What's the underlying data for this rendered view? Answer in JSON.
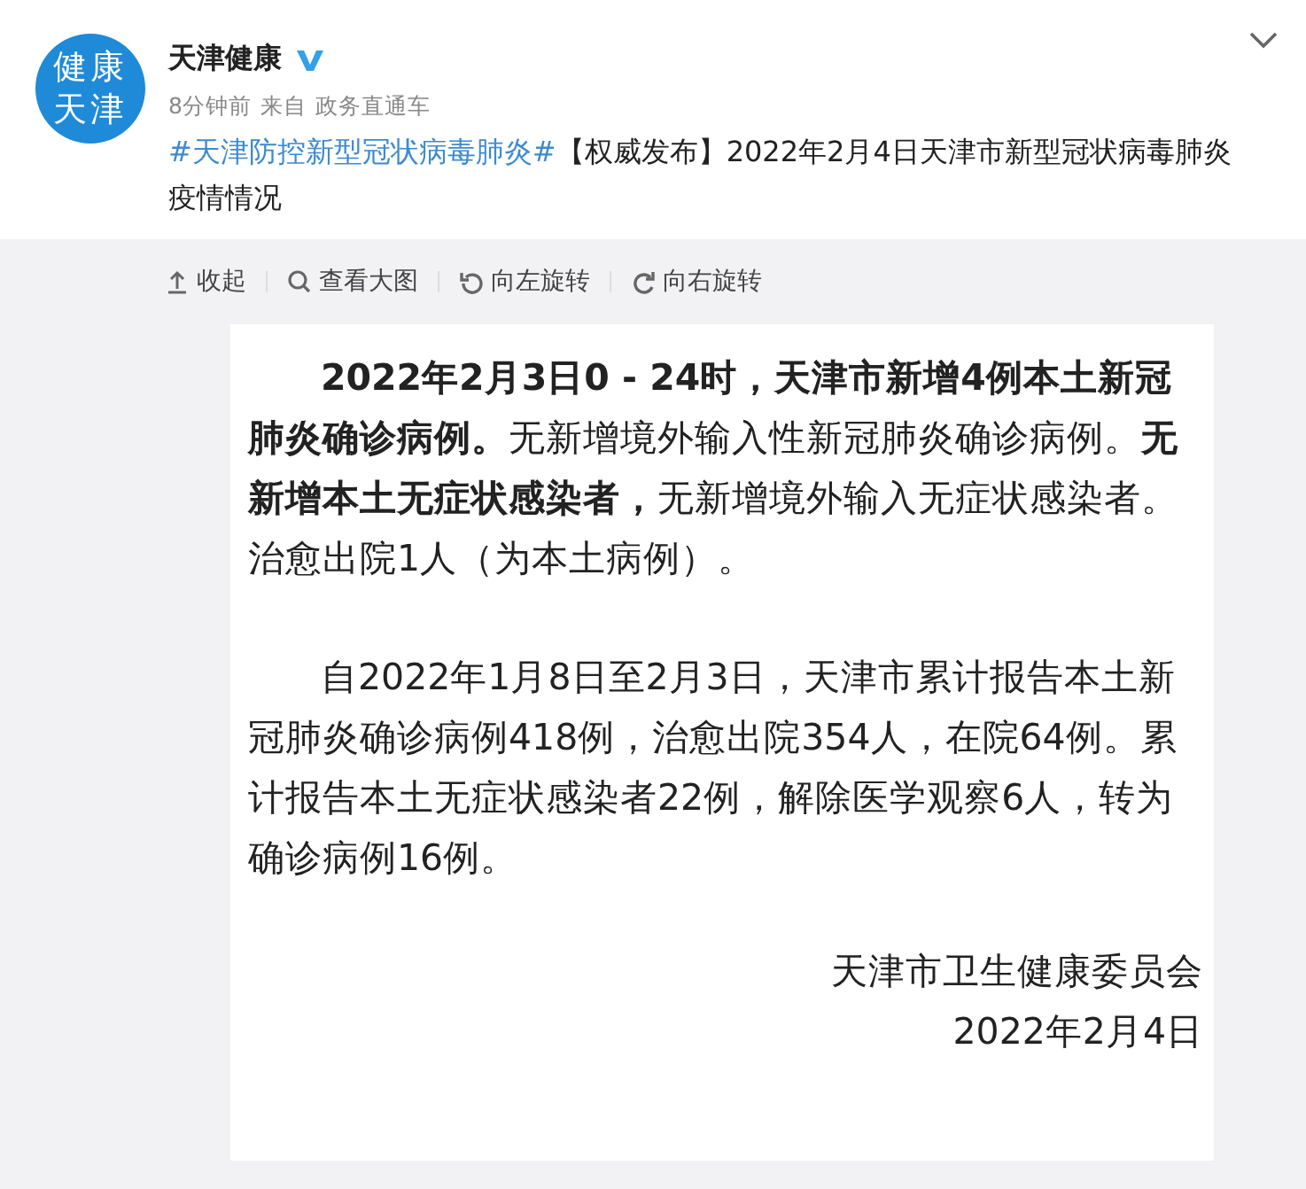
{
  "account": {
    "avatar_lines": [
      "健康",
      "天津"
    ],
    "name": "天津健康",
    "verified": true,
    "time": "8分钟前",
    "source_prefix": "来自",
    "source": "政务直通车"
  },
  "post": {
    "hashtag": "#天津防控新型冠状病毒肺炎#",
    "text": "【权威发布】2022年2月4日天津市新型冠状病毒肺炎疫情情况"
  },
  "toolbar": [
    {
      "kind": "collapse",
      "label": "收起"
    },
    {
      "kind": "zoom",
      "label": "查看大图"
    },
    {
      "kind": "rotate-left",
      "label": "向左旋转"
    },
    {
      "kind": "rotate-right",
      "label": "向右旋转"
    }
  ],
  "image": {
    "paragraphs": [
      "**2022年2月3日0 - 24时，天津市新增4例本土新冠肺炎确诊病例。**无新增境外输入性新冠肺炎确诊病例。**无新增本土无症状感染者，**无新增境外输入无症状感染者。治愈出院1人（为本土病例）。",
      "自2022年1月8日至2月3日，天津市累计报告本土新冠肺炎确诊病例418例，治愈出院354人，在院64例。累计报告本土无症状感染者22例，解除医学观察6人，转为确诊病例16例。"
    ],
    "signature": [
      "天津市卫生健康委员会",
      "2022年2月4日"
    ]
  }
}
